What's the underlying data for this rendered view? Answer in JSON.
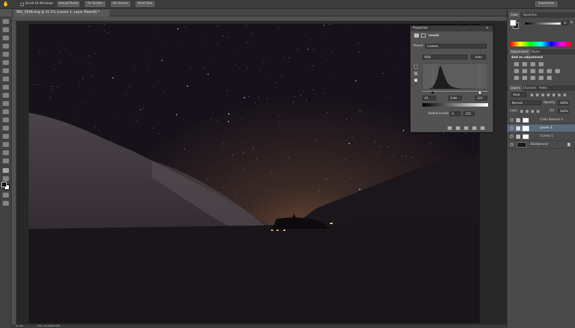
{
  "options_bar": {
    "scroll_all_label": "Scroll All Windows",
    "actual_pixels": "Actual Pixels",
    "fit_screen": "Fit Screen",
    "fill_screen": "Fill Screen",
    "print_size": "Print Size",
    "workspace": "Essentials"
  },
  "document_tab": {
    "title": "IMG_0548.dng @ 41.5% (Levels 1, Layer Mask/8) *"
  },
  "status": {
    "zoom": "41.5%",
    "doc": "Doc: 48.0M/96.0M"
  },
  "properties": {
    "title": "Properties",
    "type_label": "Levels",
    "preset_label": "Preset:",
    "preset_value": "Custom",
    "channel_value": "RGB",
    "auto_label": "Auto",
    "input_black": "45",
    "input_gray": "0.84",
    "input_white": "222",
    "output_label": "Output Levels:",
    "output_black": "0",
    "output_white": "255"
  },
  "color_panel": {
    "tab_color": "Color",
    "tab_swatches": "Swatches",
    "value": "0",
    "unit": "%"
  },
  "adjustments_panel": {
    "tab_adjustments": "Adjustments",
    "tab_styles": "Styles",
    "heading": "Add an adjustment"
  },
  "layers_panel": {
    "tab_layers": "Layers",
    "tab_channels": "Channels",
    "tab_paths": "Paths",
    "kind_label": "Kind",
    "blend_mode": "Normal",
    "opacity_label": "Opacity:",
    "opacity_value": "100%",
    "lock_label": "Lock:",
    "fill_label": "Fill:",
    "fill_value": "100%",
    "layers": [
      {
        "name": "Color Balance 1"
      },
      {
        "name": "Levels 1"
      },
      {
        "name": "Curves 1"
      },
      {
        "name": "Background"
      }
    ]
  },
  "colors": {
    "ui_dark": "#3c3c3c",
    "panel": "#4a4a4a",
    "selected_layer": "#5c6a7c",
    "sky": "#17121a",
    "horizon_glow": "#4a3328"
  }
}
